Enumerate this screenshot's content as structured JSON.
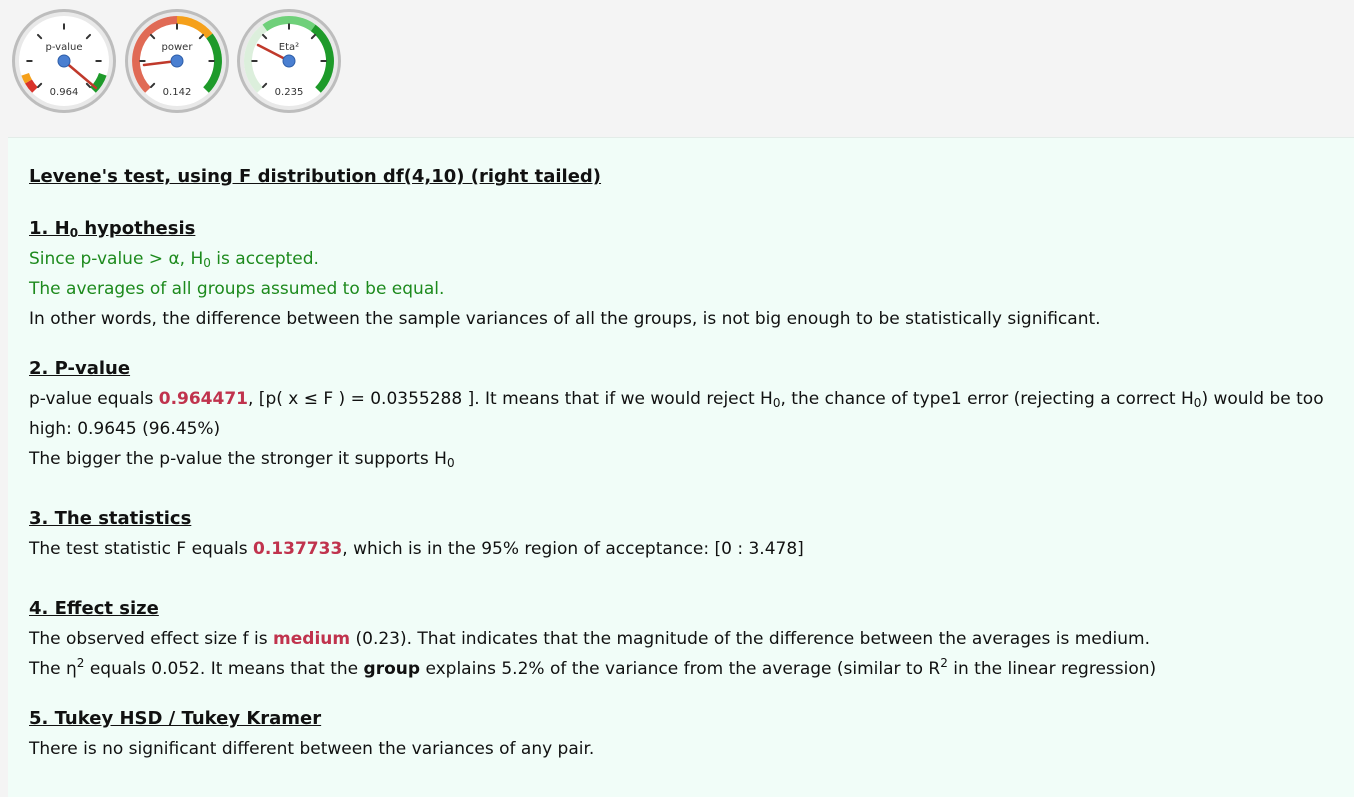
{
  "gauges": [
    {
      "label": "p-value",
      "value_text": "0.964",
      "value": 0.964
    },
    {
      "label": "power",
      "value_text": "0.142",
      "value": 0.142
    },
    {
      "label": "Eta²",
      "value_text": "0.235",
      "value": 0.235
    }
  ],
  "report": {
    "title": "Levene's test, using F distribution df(4,10) (right tailed)",
    "s1": {
      "head_num": "1. H",
      "head_sub": "0",
      "head_rest": " hypothesis",
      "l1a": "Since p-value > α, H",
      "l1sub": "0",
      "l1b": " is accepted.",
      "l2": "The averages of all groups assumed to be equal.",
      "l3": "In other words, the difference between the sample variances of all the groups, is not big enough to be statistically significant."
    },
    "s2": {
      "head": "2. P-value",
      "a": "p-value equals ",
      "pval": "0.964471",
      "b": ", [p( x ≤ F ) = 0.0355288 ]. It means that if we would reject H",
      "sub1": "0",
      "c": ", the chance of type1 error (rejecting a correct H",
      "sub2": "0",
      "d": ") would be too high: 0.9645 (96.45%)",
      "l2a": "The bigger the p-value the stronger it supports H",
      "l2sub": "0"
    },
    "s3": {
      "head": "3. The statistics",
      "a": "The test statistic F equals ",
      "fval": "0.137733",
      "b": ", which is in the 95% region of acceptance: [0 : 3.478]"
    },
    "s4": {
      "head": "4. Effect size",
      "l1a": "The observed effect size f is ",
      "size": "medium",
      "l1b": " (0.23). That indicates that the magnitude of the difference between the averages is medium.",
      "l2a": "The η",
      "l2sup1": "2",
      "l2b": " equals 0.052. It means that the ",
      "group": "group",
      "l2c": " explains 5.2% of the variance from the average (similar to R",
      "l2sup2": "2",
      "l2d": " in the linear regression)"
    },
    "s5": {
      "head": "5. Tukey HSD / Tukey Kramer",
      "l1": "There is no significant different between the variances of any pair."
    }
  }
}
